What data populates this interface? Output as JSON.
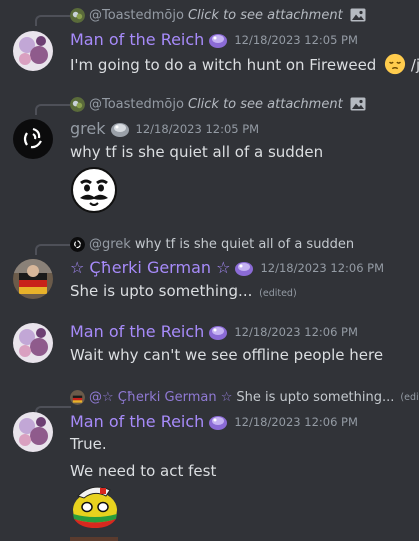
{
  "messages": [
    {
      "reply": {
        "username": "@Toastedmōjo",
        "text": "Click to see attachment"
      },
      "author": "Man of the Reich",
      "timestamp": "12/18/2023 12:05 PM",
      "text": "I'm going to do a witch hunt on Fireweed",
      "suffix": "/j",
      "emoji": "pensive-face"
    },
    {
      "reply": {
        "username": "@Toastedmōjo",
        "text": "Click to see attachment"
      },
      "author": "grek",
      "timestamp": "12/18/2023 12:05 PM",
      "text": "why tf is she quiet all of a sudden",
      "sticker": "mustache-face-emote"
    },
    {
      "reply": {
        "username": "@grek",
        "text": "why tf is she quiet all of a sudden"
      },
      "author": "☆ Çħerki German ☆",
      "timestamp": "12/18/2023 12:06 PM",
      "text": "She is upto something...",
      "edited": "(edited)"
    },
    {
      "author": "Man of the Reich",
      "timestamp": "12/18/2023 12:06 PM",
      "text": "Wait why can't we see offline people here"
    },
    {
      "reply": {
        "username": "@☆ Çħerki German ☆",
        "text": "She is upto something...",
        "edited": "(edited)"
      },
      "author": "Man of the Reich",
      "timestamp": "12/18/2023 12:06 PM",
      "text": "True.",
      "text2": "We need to act fest",
      "sticker": "countryball-emote"
    }
  ],
  "colors": {
    "background": "#313338",
    "accent_name": "#a78bfa",
    "text": "#dbdee1",
    "muted": "#949ba4"
  }
}
